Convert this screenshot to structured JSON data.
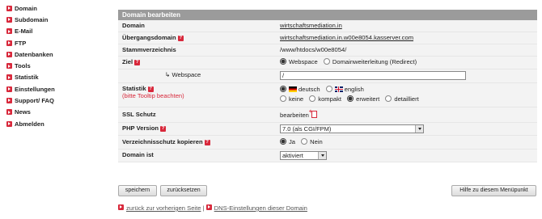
{
  "sidebar": {
    "items": [
      {
        "label": "Domain"
      },
      {
        "label": "Subdomain"
      },
      {
        "label": "E-Mail"
      },
      {
        "label": "FTP"
      },
      {
        "label": "Datenbanken"
      },
      {
        "label": "Tools"
      },
      {
        "label": "Statistik"
      },
      {
        "label": "Einstellungen"
      },
      {
        "label": "Support/ FAQ"
      },
      {
        "label": "News"
      },
      {
        "label": "Abmelden"
      }
    ]
  },
  "panel": {
    "title": "Domain bearbeiten",
    "domain": {
      "label": "Domain",
      "value": "wirtschaftsmediation.in"
    },
    "transition": {
      "label": "Übergangsdomain",
      "value": "wirtschaftsmediation.in.w00e8054.kasserver.com"
    },
    "root": {
      "label": "Stammverzeichnis",
      "value": "/www/htdocs/w00e8054/"
    },
    "target": {
      "label": "Ziel",
      "option1": "Webspace",
      "option2": "Domainweiterleitung (Redirect)"
    },
    "webspace": {
      "label": "↳ Webspace",
      "value": "/"
    },
    "stats": {
      "label": "Statistik",
      "note": "(bitte Tooltip beachten)",
      "lang1": "deutsch",
      "lang2": "english",
      "opt1": "keine",
      "opt2": "kompakt",
      "opt3": "erweitert",
      "opt4": "detailliert"
    },
    "ssl": {
      "label": "SSL Schutz",
      "value": "bearbeiten"
    },
    "php": {
      "label": "PHP Version",
      "value": "7.0 (als CGI/FPM)"
    },
    "protect": {
      "label": "Verzeichnisschutz kopieren",
      "yes": "Ja",
      "no": "Nein"
    },
    "status": {
      "label": "Domain ist",
      "value": "aktiviert"
    }
  },
  "buttons": {
    "save": "speichern",
    "reset": "zurücksetzen",
    "help": "Hilfe zu diesem Menüpunkt"
  },
  "footer": {
    "back": "zurück zur vorherigen Seite",
    "separator": "|",
    "dns": "DNS-Einstellungen dieser Domain"
  },
  "colors": {
    "accent": "#d8283b",
    "header": "#9b9b9b",
    "row": "#f3f3f3"
  }
}
